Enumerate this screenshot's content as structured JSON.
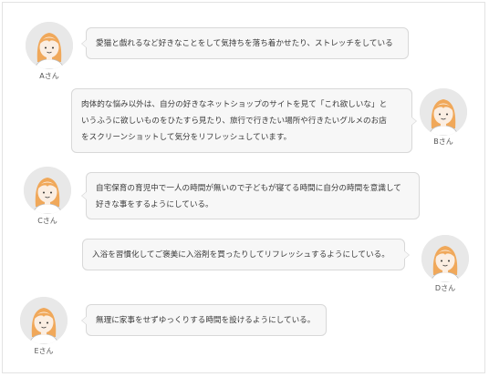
{
  "colors": {
    "hair": "#f0a85a",
    "skin": "#fbeee2",
    "avatar_bg": "#e8e8e8",
    "bubble_bg": "#f7f7f7",
    "bubble_border": "#d8d8d8"
  },
  "entries": [
    {
      "name": "Aさん",
      "side": "left",
      "text": "愛猫と戯れるなど好きなことをして気持ちを落ち着かせたり、ストレッチをしている"
    },
    {
      "name": "Bさん",
      "side": "right",
      "text": "肉体的な悩み以外は、自分の好きなネットショップのサイトを見て「これ欲しいな」と\nいうふうに欲しいものをひたすら見たり、旅行で行きたい場所や行きたいグルメのお店\nをスクリーンショットして気分をリフレッシュしています。"
    },
    {
      "name": "Cさん",
      "side": "left",
      "text": "自宅保育の育児中で一人の時間が無いので子どもが寝てる時間に自分の時間を意識して\n好きな事をするようにしている。"
    },
    {
      "name": "Dさん",
      "side": "right",
      "text": "入浴を習慣化してご褒美に入浴剤を買ったりしてリフレッシュするようにしている。"
    },
    {
      "name": "Eさん",
      "side": "left",
      "text": "無理に家事をせずゆっくりする時間を設けるようにしている。"
    }
  ]
}
